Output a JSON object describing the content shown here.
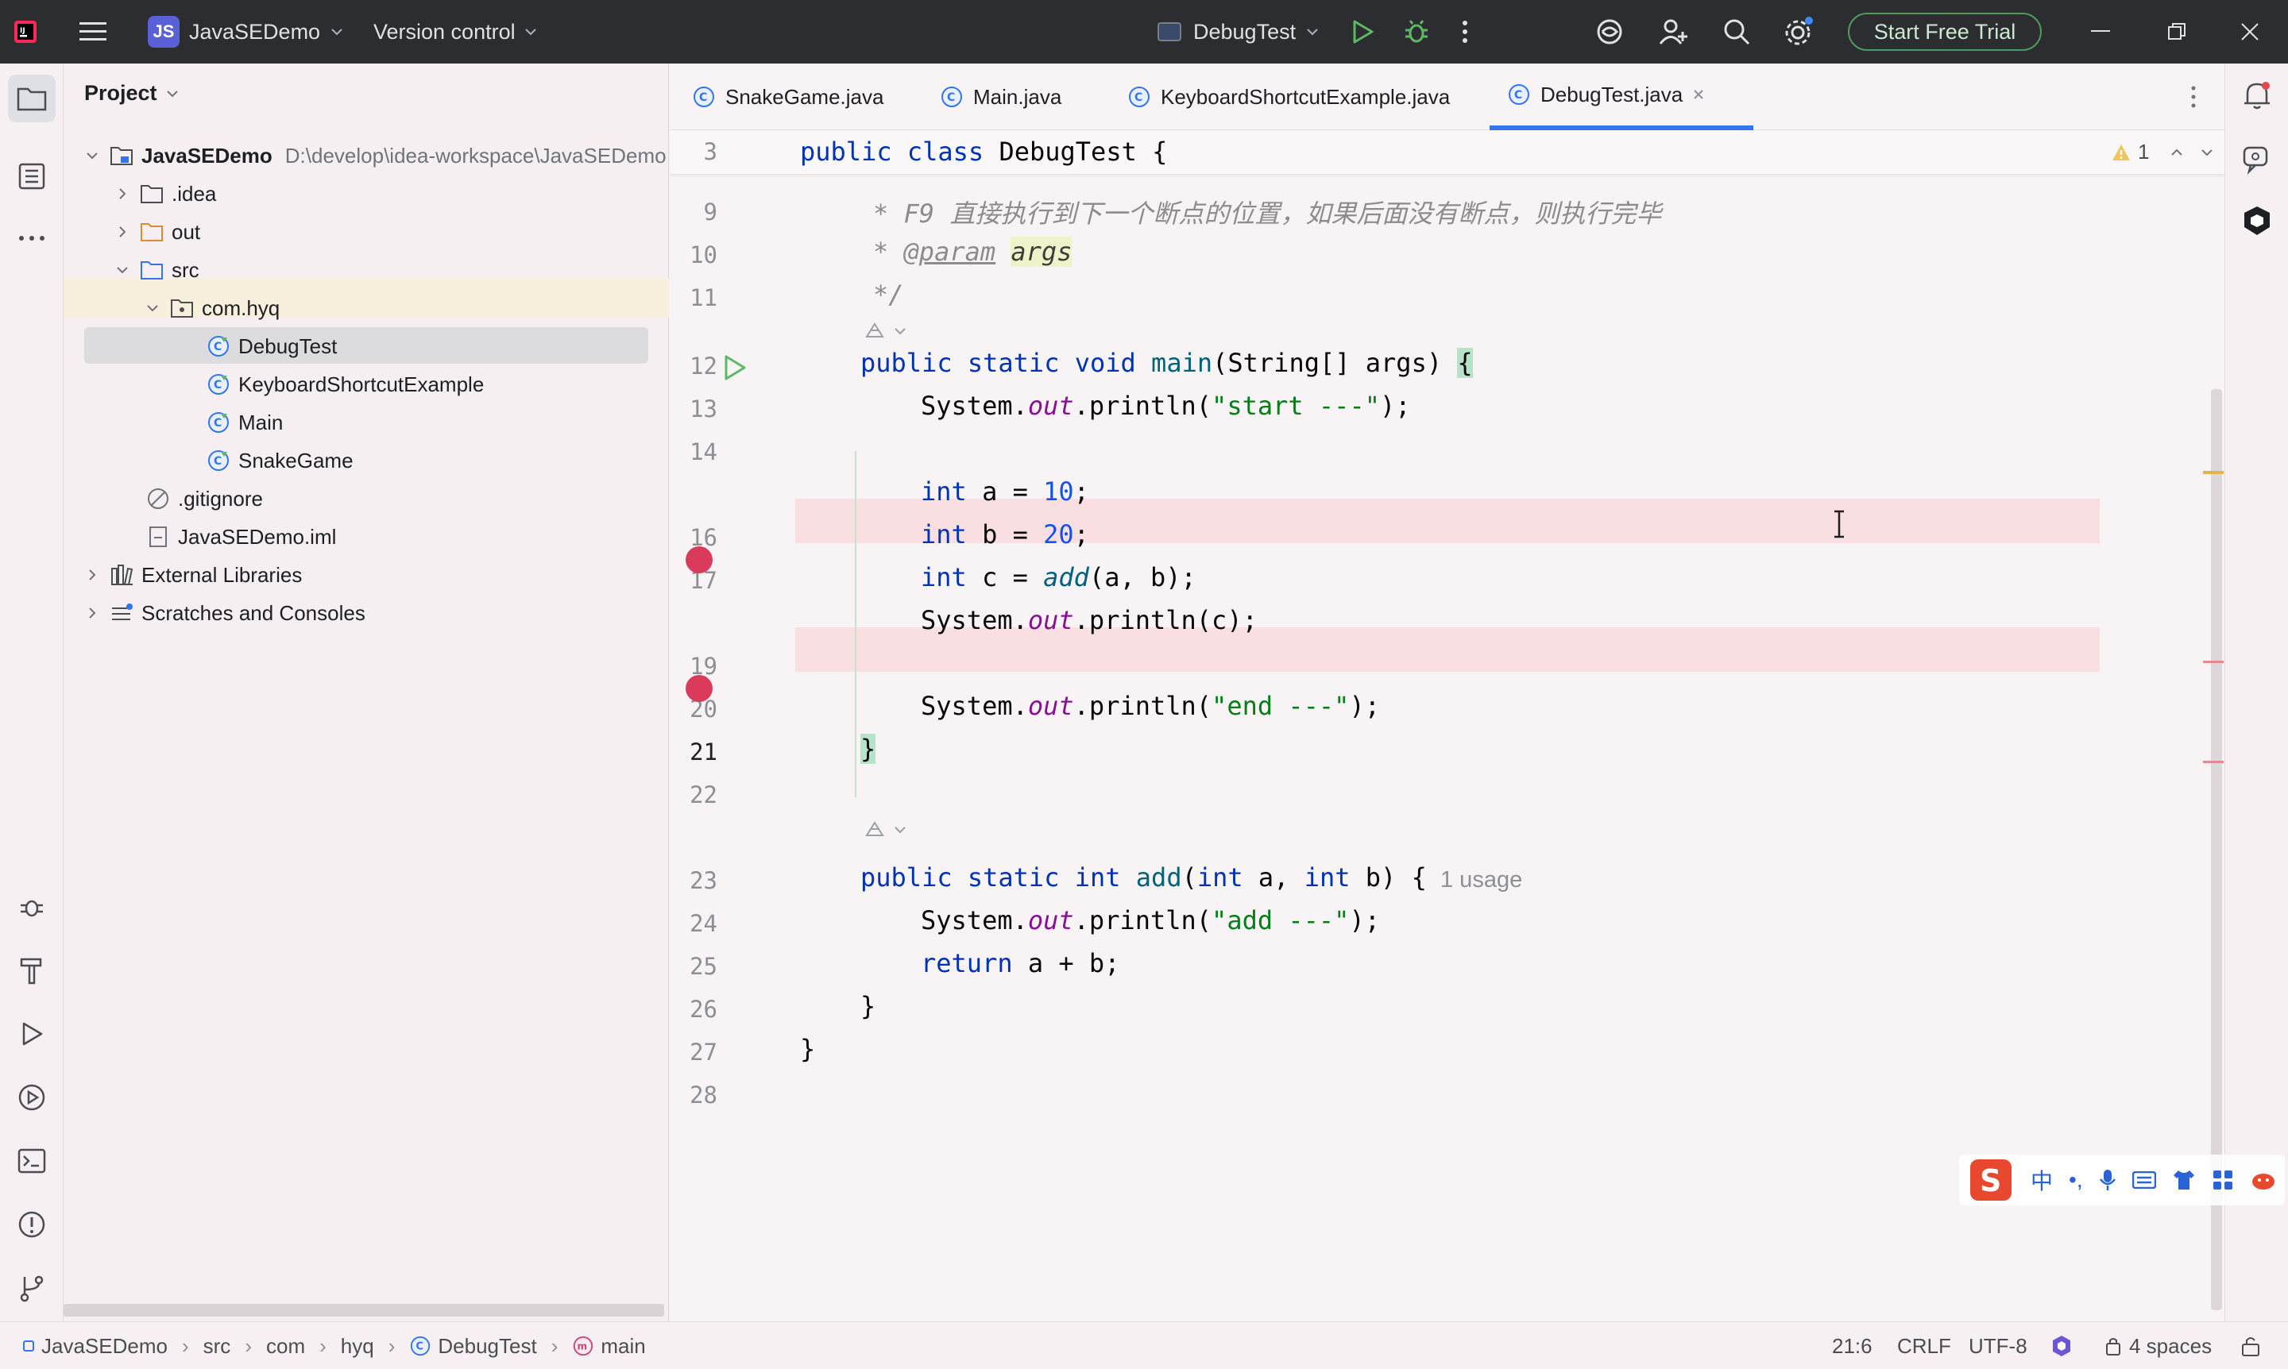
{
  "titlebar": {
    "project_badge": "JS",
    "project_name": "JavaSEDemo",
    "vcs_label": "Version control",
    "run_config": "DebugTest",
    "trial_button": "Start Free Trial"
  },
  "project_panel": {
    "title": "Project",
    "tree": [
      {
        "label": "JavaSEDemo",
        "path": "D:\\develop\\idea-workspace\\JavaSEDemo"
      },
      {
        "label": ".idea"
      },
      {
        "label": "out"
      },
      {
        "label": "src"
      },
      {
        "label": "com.hyq"
      },
      {
        "label": "DebugTest"
      },
      {
        "label": "KeyboardShortcutExample"
      },
      {
        "label": "Main"
      },
      {
        "label": "SnakeGame"
      },
      {
        "label": ".gitignore"
      },
      {
        "label": "JavaSEDemo.iml"
      },
      {
        "label": "External Libraries"
      },
      {
        "label": "Scratches and Consoles"
      }
    ]
  },
  "tabs": [
    "SnakeGame.java",
    "Main.java",
    "KeyboardShortcutExample.java",
    "DebugTest.java"
  ],
  "editor": {
    "sticky_line_number": "3",
    "sticky_line": "public class DebugTest {",
    "warning_count": "1",
    "line_numbers": [
      "9",
      "10",
      "11",
      "12",
      "13",
      "14",
      "16",
      "17",
      "19",
      "20",
      "21",
      "22",
      "23",
      "24",
      "25",
      "26",
      "27",
      "28"
    ],
    "comment_f9": "* F9 直接执行到下一个断点的位置，如果后面没有断点，则执行完毕",
    "comment_param_star": "* ",
    "comment_param_tag": "@param",
    "comment_param_name": "args",
    "comment_end": "*/",
    "usage_hint": "1 usage"
  },
  "ime": {
    "lang": "中",
    "punct": "•,"
  },
  "statusbar": {
    "crumbs": [
      "JavaSEDemo",
      "src",
      "com",
      "hyq",
      "DebugTest",
      "main"
    ],
    "position": "21:6",
    "line_sep": "CRLF",
    "encoding": "UTF-8",
    "indent": "4 spaces"
  }
}
